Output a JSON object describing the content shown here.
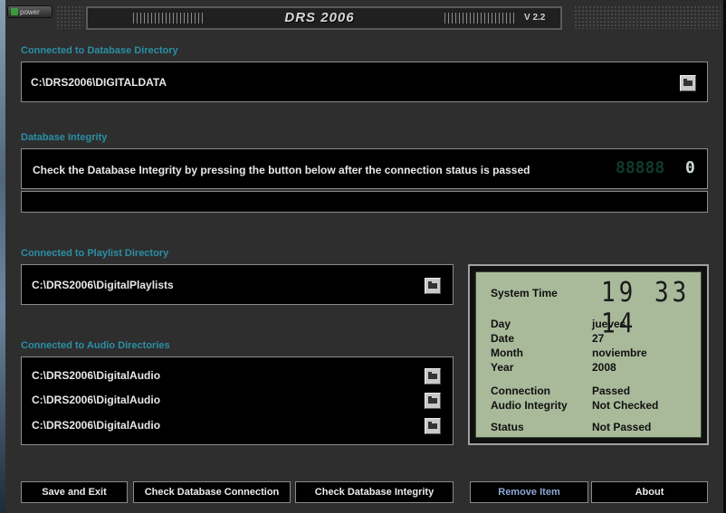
{
  "window": {
    "power_label": "power",
    "title": "DRS 2006",
    "version": "V 2.2"
  },
  "database_directory": {
    "label": "Connected to Database Directory",
    "path": "C:\\DRS2006\\DIGITALDATA"
  },
  "integrity": {
    "label": "Database Integrity",
    "message": "Check the Database Integrity by pressing the button below after the connection status is passed",
    "counter_dim": "88888",
    "counter_value": "0",
    "progress_fraction": 0
  },
  "playlist_directory": {
    "label": "Connected to Playlist Directory",
    "path": "C:\\DRS2006\\DigitalPlaylists"
  },
  "audio_directories": {
    "label": "Connected to Audio Directories",
    "paths": [
      "C:\\DRS2006\\DigitalAudio",
      "C:\\DRS2006\\DigitalAudio",
      "C:\\DRS2006\\DigitalAudio"
    ]
  },
  "status_panel": {
    "system_time_label": "System Time",
    "clock": "19 33 14",
    "day_label": "Day",
    "day_value": "jueves",
    "date_label": "Date",
    "date_value": "27",
    "month_label": "Month",
    "month_value": "noviembre",
    "year_label": "Year",
    "year_value": "2008",
    "connection_label": "Connection",
    "connection_value": "Passed",
    "audio_integrity_label": "Audio Integrity",
    "audio_integrity_value": "Not Checked",
    "status_label": "Status",
    "status_value": "Not Passed"
  },
  "buttons": {
    "save_exit": "Save and Exit",
    "check_connection": "Check Database Connection",
    "check_integrity": "Check Database Integrity",
    "remove_item": "Remove Item",
    "about": "About"
  },
  "colors": {
    "section_label": "#2a8fa4",
    "lcd_background": "#a9ba9b",
    "disabled_button_text": "#8ea8d8"
  }
}
